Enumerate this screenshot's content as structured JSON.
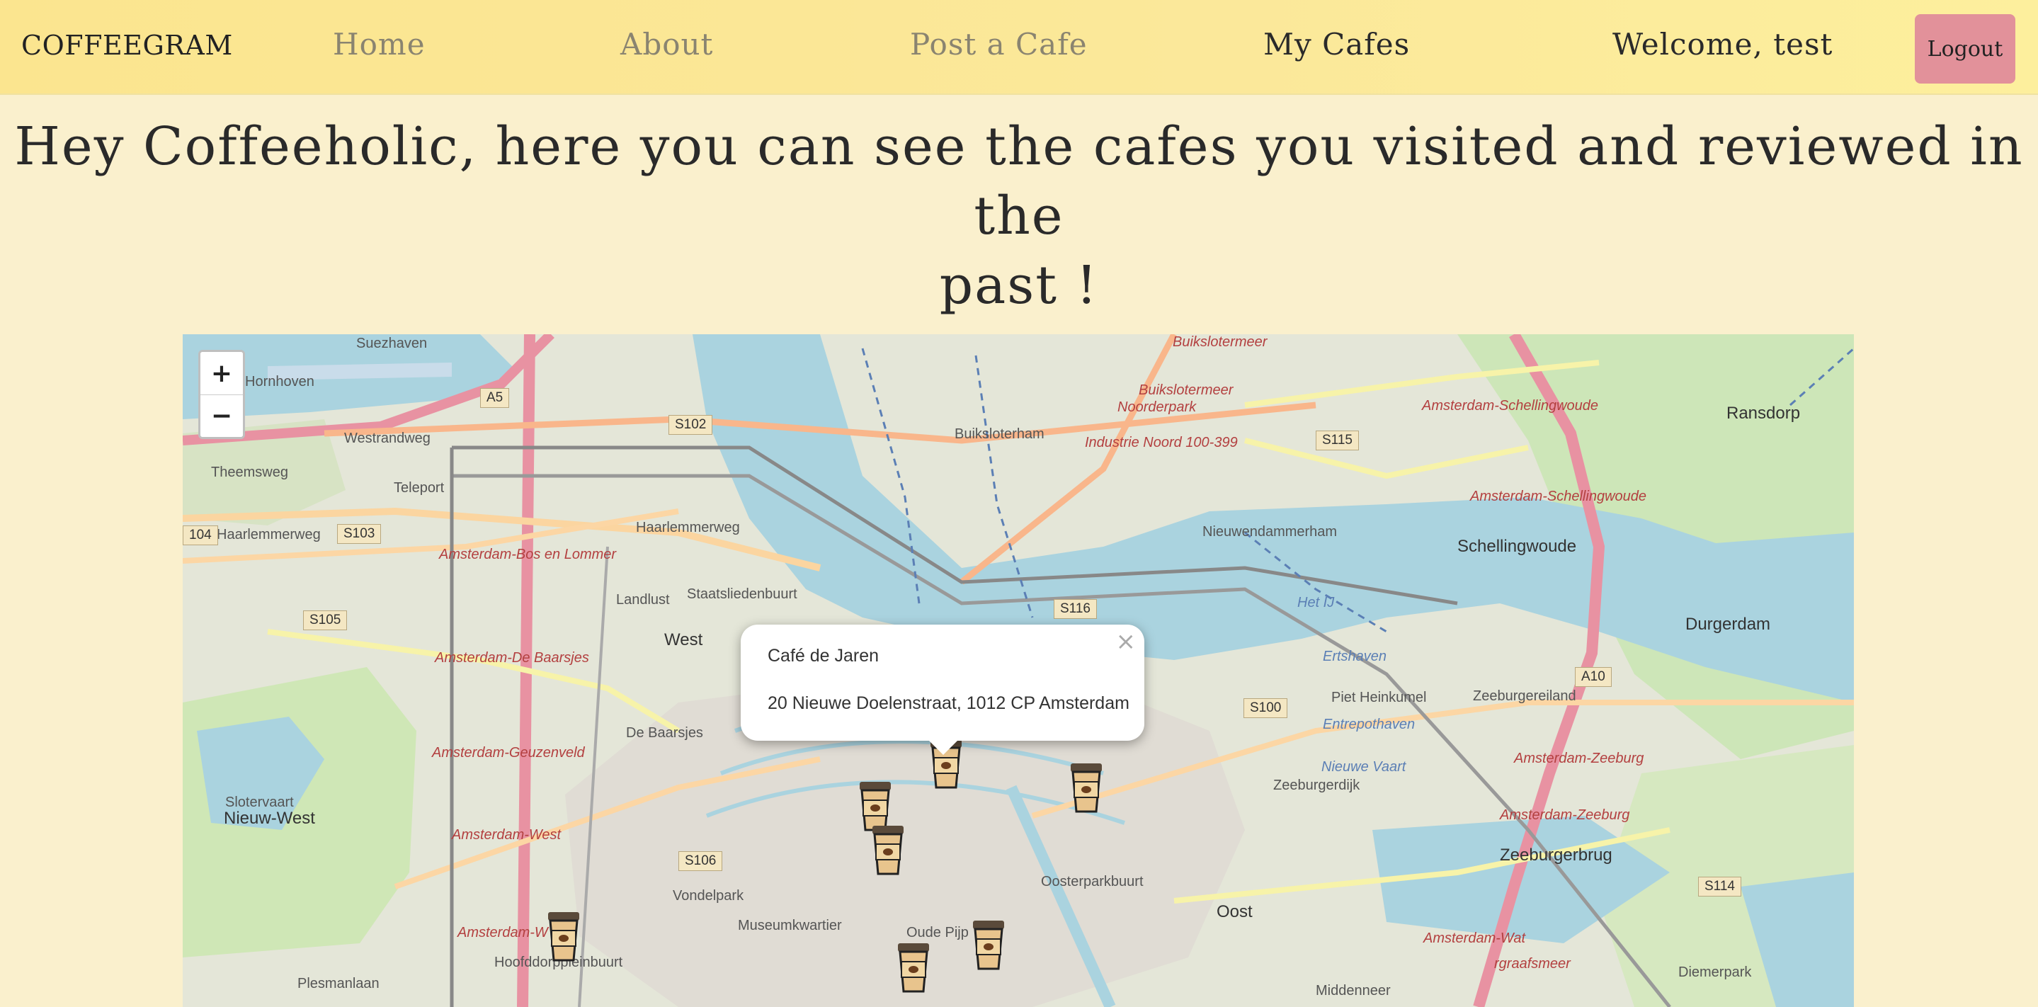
{
  "navbar": {
    "brand": "COFFEEGRAM",
    "links": [
      {
        "label": "Home"
      },
      {
        "label": "About"
      },
      {
        "label": "Post a Cafe"
      },
      {
        "label": "My Cafes"
      }
    ],
    "welcome": "Welcome, test",
    "logout": "Logout"
  },
  "heading": {
    "line1": "Hey Coffeeholic, here you can see the cafes you visited and reviewed in the",
    "line2": "past !"
  },
  "map": {
    "zoom_in": "+",
    "zoom_out": "−",
    "labels": {
      "suezhaven": "Suezhaven",
      "hornhoven": "Hornhoven",
      "westrandweg": "Westrandweg",
      "theemsweg": "Theemsweg",
      "teleport": "Teleport",
      "haarlemmerweg": "Haarlemmerweg",
      "haarlemmerweg2": "Haarlemmerweg",
      "bos_en_lommer": "Amsterdam-Bos en Lommer",
      "landlust": "Landlust",
      "staatslieden": "Staatsliedenbuurt",
      "west": "West",
      "de_baarsjes": "Amsterdam-De Baarsjes",
      "de_baarsjes2": "De Baarsjes",
      "geuzenveld": "Amsterdam-Geuzenveld",
      "slotervaart": "Slotervaart",
      "nieuw_west": "Nieuw-West",
      "amsterdam_west": "Amsterdam-West",
      "vondelpark": "Vondelpark",
      "museumkwartier": "Museumkwartier",
      "oude_pijp": "Oude Pijp",
      "amsterdam_w": "Amsterdam-W",
      "hoofddorp": "Hoofddorppleinbuurt",
      "plesmanlaan": "Plesmanlaan",
      "buikslotermeer": "Buikslotermeer",
      "buikslotermeer2": "Buikslotermeer",
      "noorderpark": "Noorderpark",
      "buiksloterham": "Buiksloterham",
      "industrie_noord": "Industrie Noord 100-399",
      "nieuwendammerham": "Nieuwendammerham",
      "het_ij": "Het IJ",
      "ertshaven": "Ertshaven",
      "entrepothaven": "Entrepothaven",
      "nieuwe_vaart": "Nieuwe Vaart",
      "zeeburgerdijk": "Zeeburgerdijk",
      "oosterparkbuurt": "Oosterparkbuurt",
      "oost": "Oost",
      "middenneer": "Middenneer",
      "schellingwoude": "Schellingwoude",
      "schellingwoude_15a": "Amsterdam-Schellingwoude",
      "schellingwoude_15b": "Amsterdam-Schellingwoude",
      "ransdorp": "Ransdorp",
      "durgerdam": "Durgerdam",
      "zeeburgereiland": "Zeeburgereiland",
      "zeeburg_14a": "Amsterdam-Zeeburg",
      "zeeburg_14b": "Amsterdam-Zeeburg",
      "zeeburgerbrug": "Zeeburgerbrug",
      "amsterdam_wat": "Amsterdam-Wat",
      "graafsmeer": "rgraafsmeer",
      "diemerpark": "Diemerpark",
      "piet_hein": "Piet Heinkumel"
    },
    "shields": {
      "a5": "A5",
      "s102": "S102",
      "s103": "S103",
      "s104": "104",
      "s105": "S105",
      "s106": "S106",
      "s115": "S115",
      "s116": "S116",
      "s100": "S100",
      "a10": "A10",
      "s114": "S114"
    }
  },
  "popup": {
    "title": "Café de Jaren",
    "address": "20 Nieuwe Doelenstraat, 1012 CP Amsterdam",
    "close": "×"
  },
  "colors": {
    "navbar": "#fbe58f",
    "background": "#faf0cd",
    "logout": "#e2919a"
  }
}
